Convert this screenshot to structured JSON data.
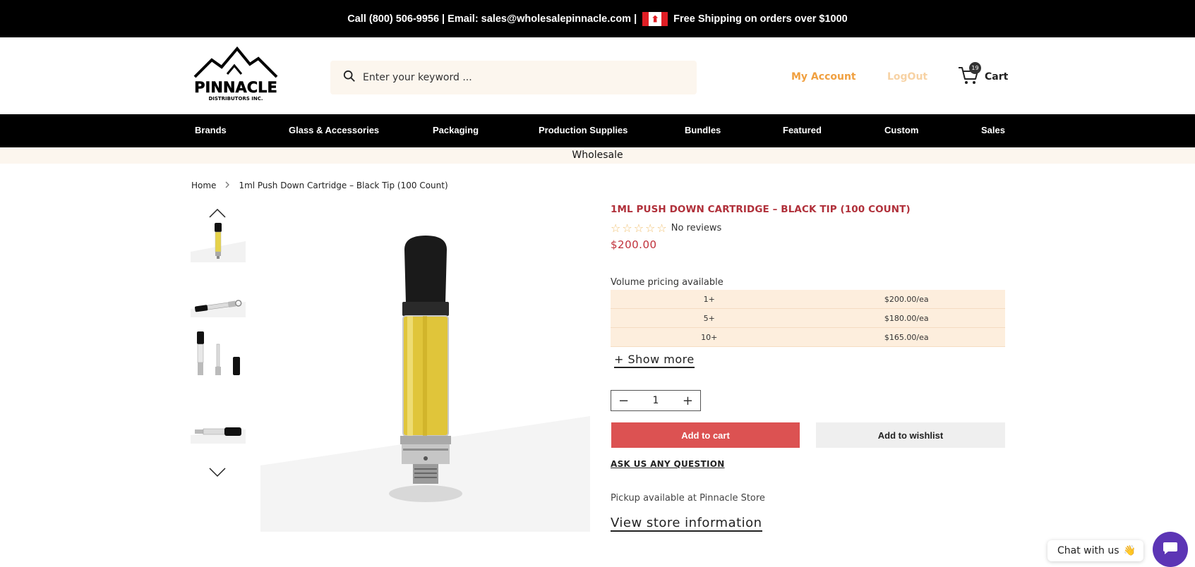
{
  "topbar": {
    "text_left": "Call (800) 506-9956 | Email: sales@wholesalepinnacle.com |",
    "text_right": "Free Shipping on orders over $1000"
  },
  "header": {
    "logo_text": "PINNACLE",
    "logo_sub": "DISTRIBUTORS INC.",
    "search_placeholder": "Enter your keyword ...",
    "my_account": "My Account",
    "logout": "LogOut",
    "cart_label": "Cart",
    "cart_count": "19"
  },
  "nav": {
    "items": [
      "Brands",
      "Glass & Accessories",
      "Packaging",
      "Production Supplies",
      "Bundles",
      "Featured",
      "Custom",
      "Sales"
    ],
    "subnav": "Wholesale"
  },
  "breadcrumb": {
    "home": "Home",
    "current": "1ml Push Down Cartridge – Black Tip (100 Count)"
  },
  "product": {
    "title": "1ML PUSH DOWN CARTRIDGE – BLACK TIP (100 COUNT)",
    "reviews": "No reviews",
    "price": "$200.00",
    "volume_label": "Volume pricing available",
    "volume_tiers": [
      {
        "qty": "1+",
        "price": "$200.00/ea"
      },
      {
        "qty": "5+",
        "price": "$180.00/ea"
      },
      {
        "qty": "10+",
        "price": "$165.00/ea"
      }
    ],
    "show_more": "+ Show more",
    "quantity": "1",
    "add_to_cart": "Add to cart",
    "add_to_wishlist": "Add to wishlist",
    "ask_question": "ASK US ANY QUESTION",
    "pickup": "Pickup available at Pinnacle Store",
    "store_info": "View store information"
  },
  "chat": {
    "label": "Chat with us",
    "emoji": "👋"
  },
  "colors": {
    "accent_red": "#dc5252",
    "title_red": "#b0303a",
    "account_orange": "#f0a040",
    "cream": "#fcf6ee",
    "chat_purple": "#5c35b5"
  }
}
